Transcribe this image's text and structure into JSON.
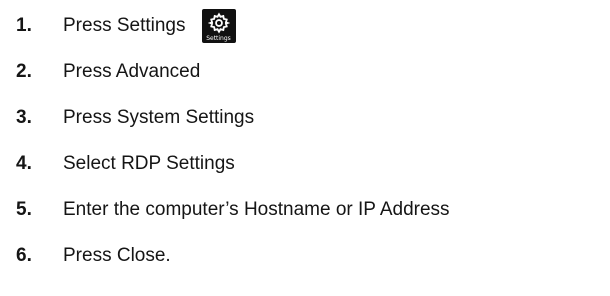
{
  "steps": [
    {
      "number": "1.",
      "text": "Press Settings",
      "icon": "settings-gear-icon",
      "icon_label": "Settings"
    },
    {
      "number": "2.",
      "text": "Press Advanced"
    },
    {
      "number": "3.",
      "text": "Press System Settings"
    },
    {
      "number": "4.",
      "text": "Select RDP Settings"
    },
    {
      "number": "5.",
      "text": "Enter the computer’s Hostname or IP Address"
    },
    {
      "number": "6.",
      "text": "Press Close."
    }
  ],
  "colors": {
    "text": "#151515",
    "icon_bg": "#111111",
    "icon_fg": "#ffffff"
  }
}
